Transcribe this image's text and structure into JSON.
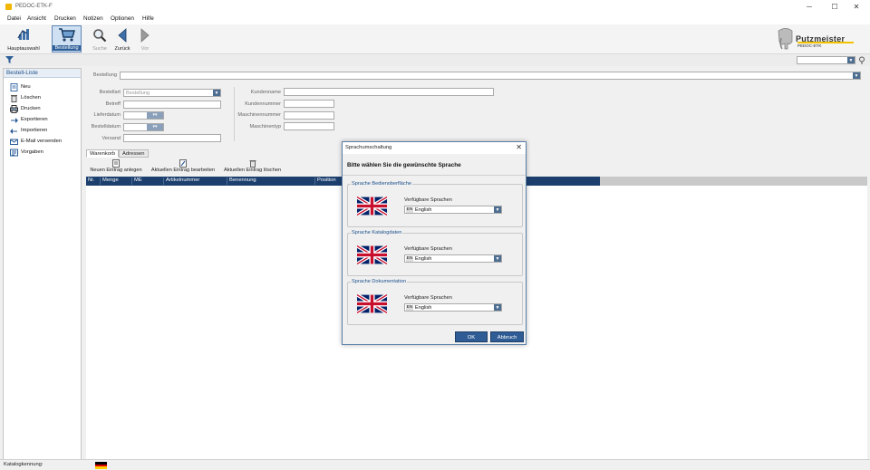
{
  "window": {
    "title": "PEDOC-ETK-F",
    "minimize": "─",
    "maximize": "☐",
    "close": "✕"
  },
  "menu": [
    {
      "label": "Datei"
    },
    {
      "label": "Ansicht"
    },
    {
      "label": "Drucken"
    },
    {
      "label": "Notizen"
    },
    {
      "label": "Optionen"
    },
    {
      "label": "Hilfe"
    }
  ],
  "toolbar": {
    "hauptauswahl": "Hauptauswahl",
    "bestellung": "Bestellung",
    "suche": "Suche",
    "zurueck": "Zurück",
    "vor": "Vor"
  },
  "logo": {
    "brand": "Putzmeister",
    "product": "PEDOC-ETK"
  },
  "sidebar": {
    "title": "Bestell-Liste",
    "items": [
      {
        "label": "Neu"
      },
      {
        "label": "Löschen"
      },
      {
        "label": "Drucken"
      },
      {
        "label": "Exportieren"
      },
      {
        "label": "Importieren"
      },
      {
        "label": "E-Mail versenden"
      },
      {
        "label": "Vorgaben"
      }
    ]
  },
  "form": {
    "bestellung_label": "Bestellung",
    "bestellart_label": "Bestellart",
    "bestellart_value": "Bestellung",
    "betreff_label": "Betreff",
    "lieferdatum_label": "Lieferdatum",
    "bestelldatum_label": "Bestelldatum",
    "versand_label": "Versand",
    "kundenname_label": "Kundenname",
    "kundennummer_label": "Kundennummer",
    "maschinennummer_label": "Maschinennummer",
    "maschinentyp_label": "Maschinentyp"
  },
  "tabs": [
    {
      "label": "Warenkorb"
    },
    {
      "label": "Adressen"
    }
  ],
  "subtoolbar": {
    "neu": "Neuen Eintrag anlegen",
    "bearbeiten": "Aktuellen Eintrag bearbeiten",
    "loeschen": "Aktuellen Eintrag löschen"
  },
  "table": {
    "columns": [
      "Nr.",
      "Menge",
      "ME",
      "Artikelnummer",
      "Benennung",
      "Position"
    ]
  },
  "status": {
    "label": "Katalogkennung:"
  },
  "dialog": {
    "title": "Sprachumschaltung",
    "close": "✕",
    "heading": "Bitte wählen Sie die gewünschte Sprache",
    "groups": [
      {
        "title": "Sprache Bedienoberfläche",
        "avail_label": "Verfügbare Sprachen",
        "code": "EN",
        "language": "English"
      },
      {
        "title": "Sprache Katalogdaten",
        "avail_label": "Verfügbare Sprachen",
        "code": "EN",
        "language": "English"
      },
      {
        "title": "Sprache Dokumentation",
        "avail_label": "Verfügbare Sprachen",
        "code": "EN",
        "language": "English"
      }
    ],
    "ok": "OK",
    "cancel": "Abbruch"
  },
  "colors": {
    "accent": "#2d5e97",
    "table_header": "#1c3f6e",
    "brand_yellow": "#f2c200"
  }
}
